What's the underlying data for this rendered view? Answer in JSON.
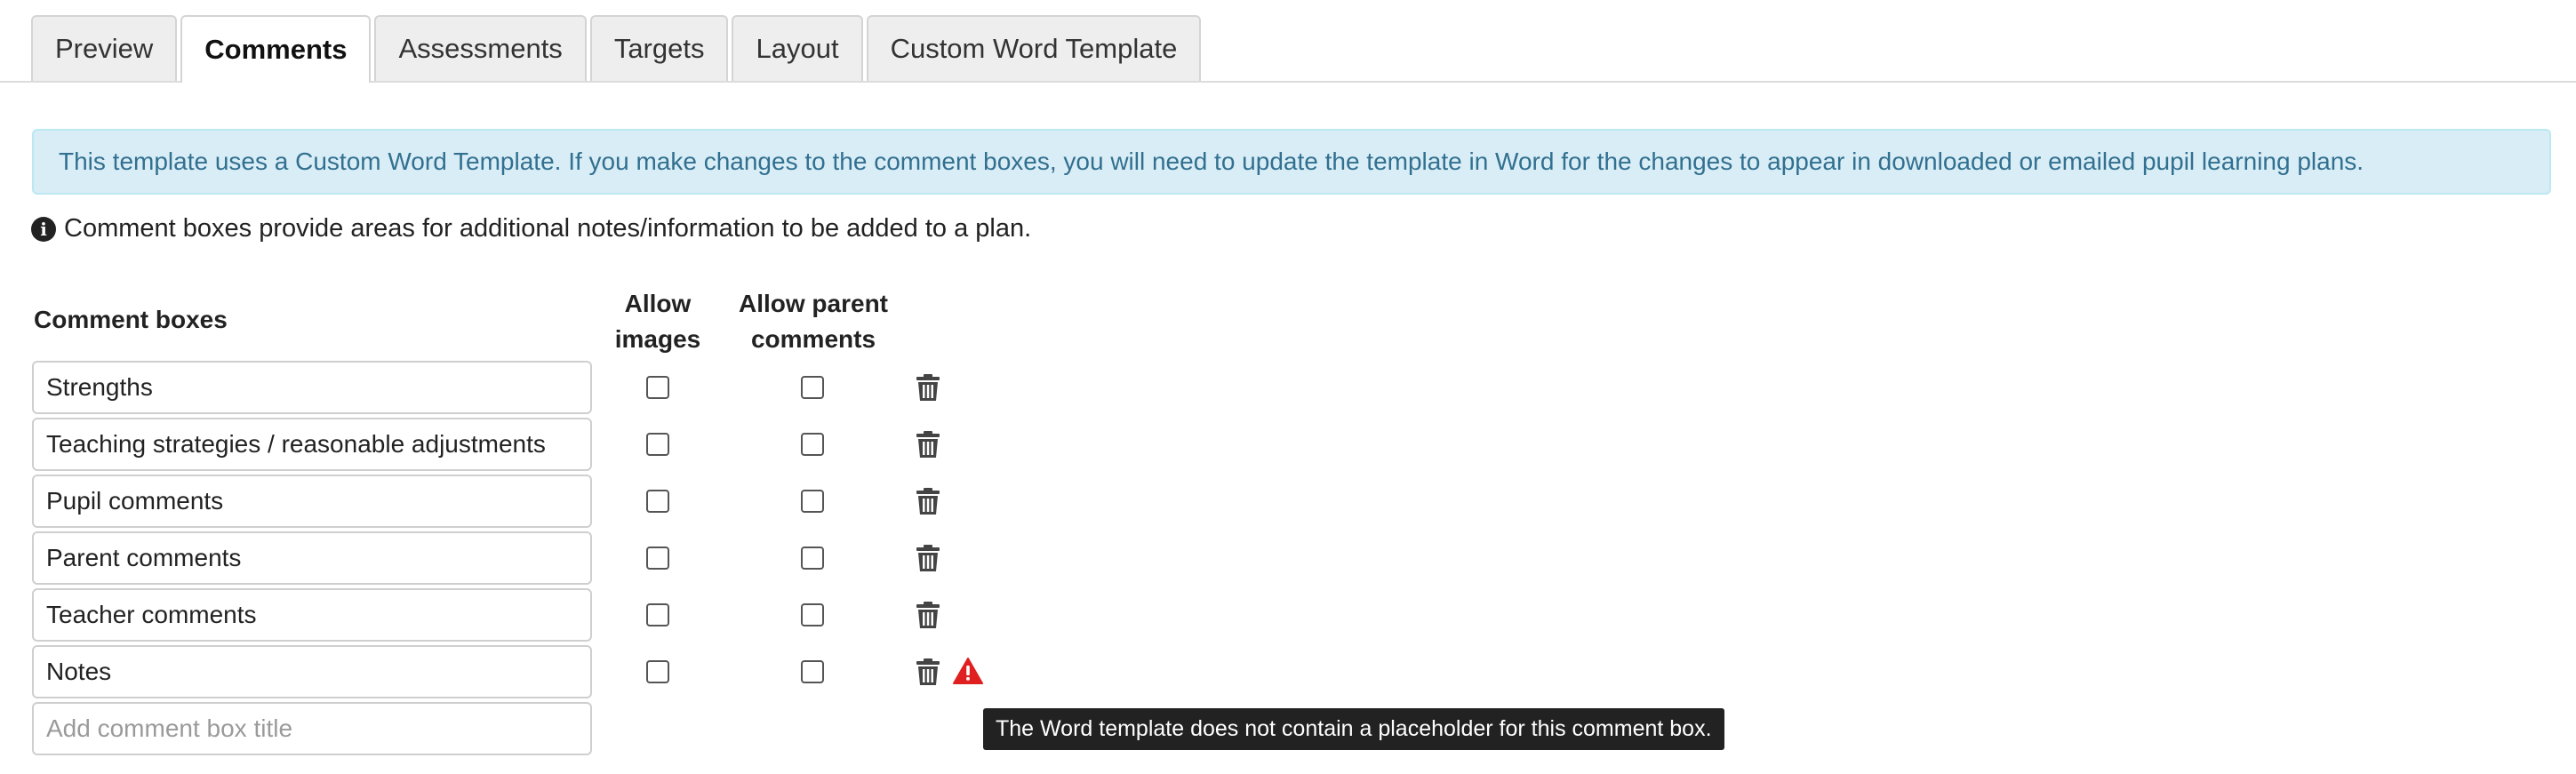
{
  "tabs": [
    {
      "label": "Preview",
      "active": false
    },
    {
      "label": "Comments",
      "active": true
    },
    {
      "label": "Assessments",
      "active": false
    },
    {
      "label": "Targets",
      "active": false
    },
    {
      "label": "Layout",
      "active": false
    },
    {
      "label": "Custom Word Template",
      "active": false
    }
  ],
  "alert": {
    "text": "This template uses a Custom Word Template. If you make changes to the comment boxes, you will need to update the template in Word for the changes to appear in downloaded or emailed pupil learning plans.",
    "background": "#d9edf7",
    "color": "#31708f"
  },
  "info": {
    "icon": "info-circle-icon",
    "text": "Comment boxes provide areas for additional notes/information to be added to a plan."
  },
  "table": {
    "headers": {
      "comment_boxes": "Comment boxes",
      "allow_images_line1": "Allow",
      "allow_images_line2": "images",
      "allow_parent_line1": "Allow parent",
      "allow_parent_line2": "comments"
    },
    "rows": [
      {
        "title": "Strengths",
        "allow_images": false,
        "allow_parent": false,
        "warning": false
      },
      {
        "title": "Teaching strategies / reasonable adjustments",
        "allow_images": false,
        "allow_parent": false,
        "warning": false
      },
      {
        "title": "Pupil comments",
        "allow_images": false,
        "allow_parent": false,
        "warning": false
      },
      {
        "title": "Parent comments",
        "allow_images": false,
        "allow_parent": false,
        "warning": false
      },
      {
        "title": "Teacher comments",
        "allow_images": false,
        "allow_parent": false,
        "warning": false
      },
      {
        "title": "Notes",
        "allow_images": false,
        "allow_parent": false,
        "warning": true
      }
    ],
    "new_row": {
      "placeholder": "Add comment box title"
    }
  },
  "tooltip": {
    "text": "The Word template does not contain a placeholder for this comment box."
  },
  "colors": {
    "warning": "#e02020",
    "trash": "#444444"
  }
}
